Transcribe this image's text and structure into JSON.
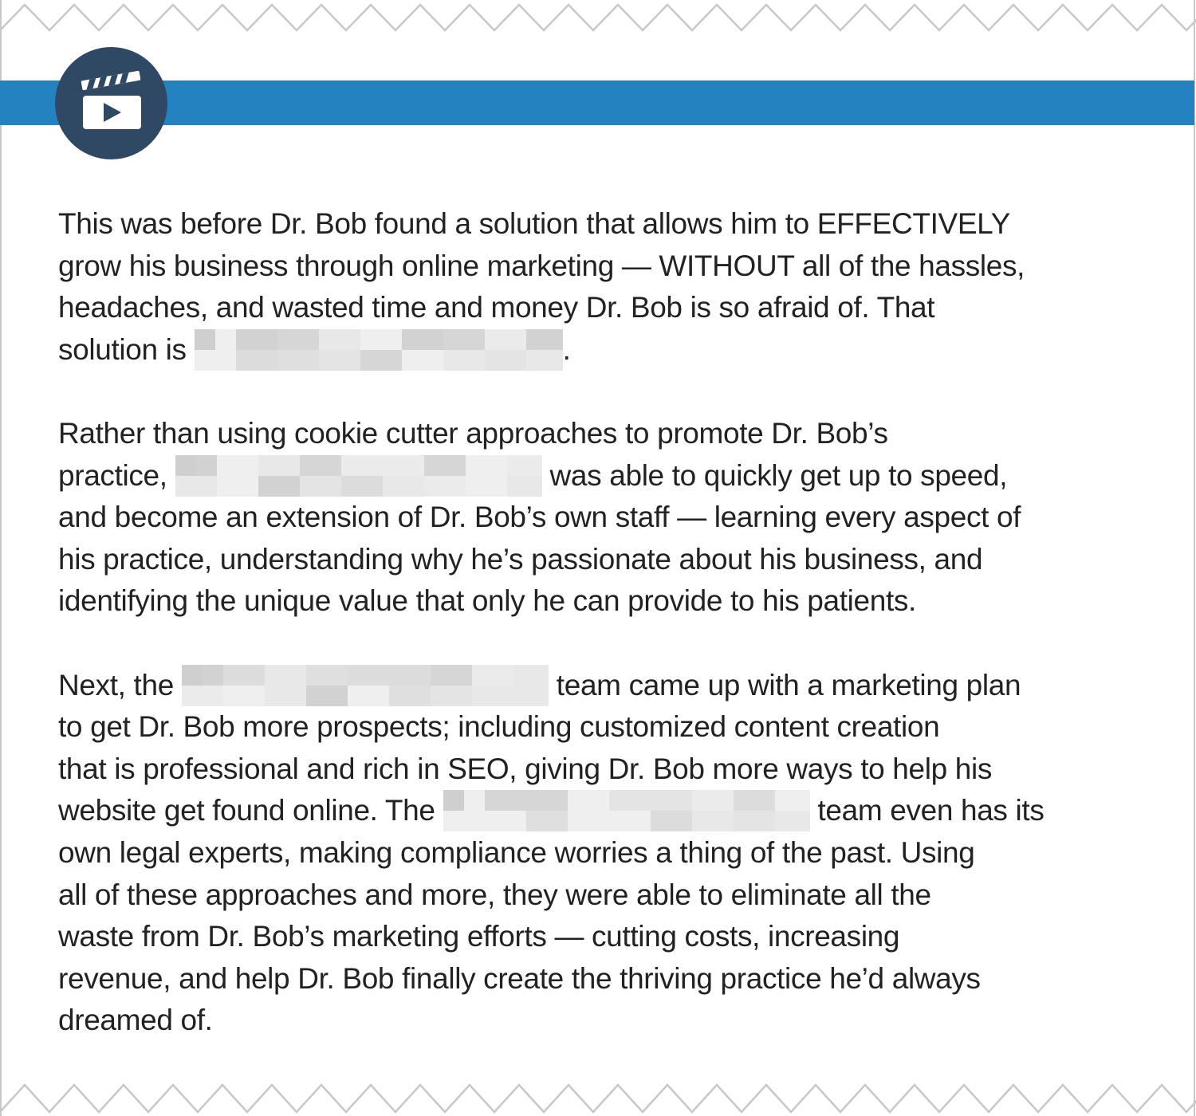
{
  "header": {
    "icon": "clapperboard-play-icon",
    "bar_color": "#2582c0",
    "badge_color": "#2f4863"
  },
  "article": {
    "paragraph_1": {
      "line_1": "This was before Dr. Bob found a solution that allows him to EFFECTIVELY",
      "line_2": "grow his business through online marketing — WITHOUT all of the hassles,",
      "line_3": "headaches, and wasted time and money Dr. Bob is so afraid of. That",
      "line_4_before": "solution is ",
      "line_4_after": "."
    },
    "paragraph_2": {
      "line_1": "Rather than using cookie cutter approaches to promote Dr. Bob’s",
      "line_2_before": "practice, ",
      "line_2_after": " was able to quickly get up to speed,",
      "line_3": "and become an extension of Dr. Bob’s own staff — learning every aspect of",
      "line_4": "his practice, understanding why he’s passionate about his business, and",
      "line_5": "identifying the unique value that only he can provide to his patients."
    },
    "paragraph_3": {
      "line_1_before": "Next, the ",
      "line_1_after": " team came up with a marketing plan",
      "line_2": "to get Dr. Bob more prospects; including customized content creation",
      "line_3": "that is professional and rich in SEO, giving Dr. Bob more ways to help his",
      "line_4_before": "website get found online. The ",
      "line_4_after": " team even has its",
      "line_5": "own legal experts, making compliance worries a thing of the past. Using",
      "line_6": "all of these approaches and more, they were able to eliminate all the",
      "line_7": "waste from Dr. Bob’s marketing efforts — cutting costs, increasing",
      "line_8": "revenue, and help Dr. Bob finally create the thriving practice he’d always",
      "line_9": "dreamed of."
    }
  }
}
